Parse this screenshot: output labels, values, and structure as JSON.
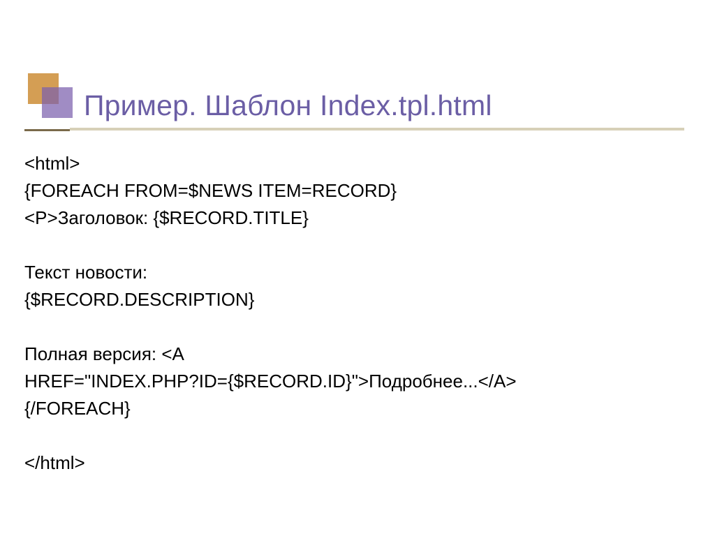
{
  "title": "Пример. Шаблон Index.tpl.html",
  "lines": {
    "l1": "<html>",
    "l2": "{FOREACH FROM=$NEWS ITEM=RECORD}",
    "l3": "<P>Заголовок: {$RECORD.TITLE}",
    "l4": "Текст новости:",
    "l5": " {$RECORD.DESCRIPTION}",
    "l6": "Полная версия: <A",
    "l7": "    HREF=\"INDEX.PHP?ID={$RECORD.ID}\">Подробнее...</A>",
    "l8": "{/FOREACH}",
    "l9": "</html>"
  }
}
